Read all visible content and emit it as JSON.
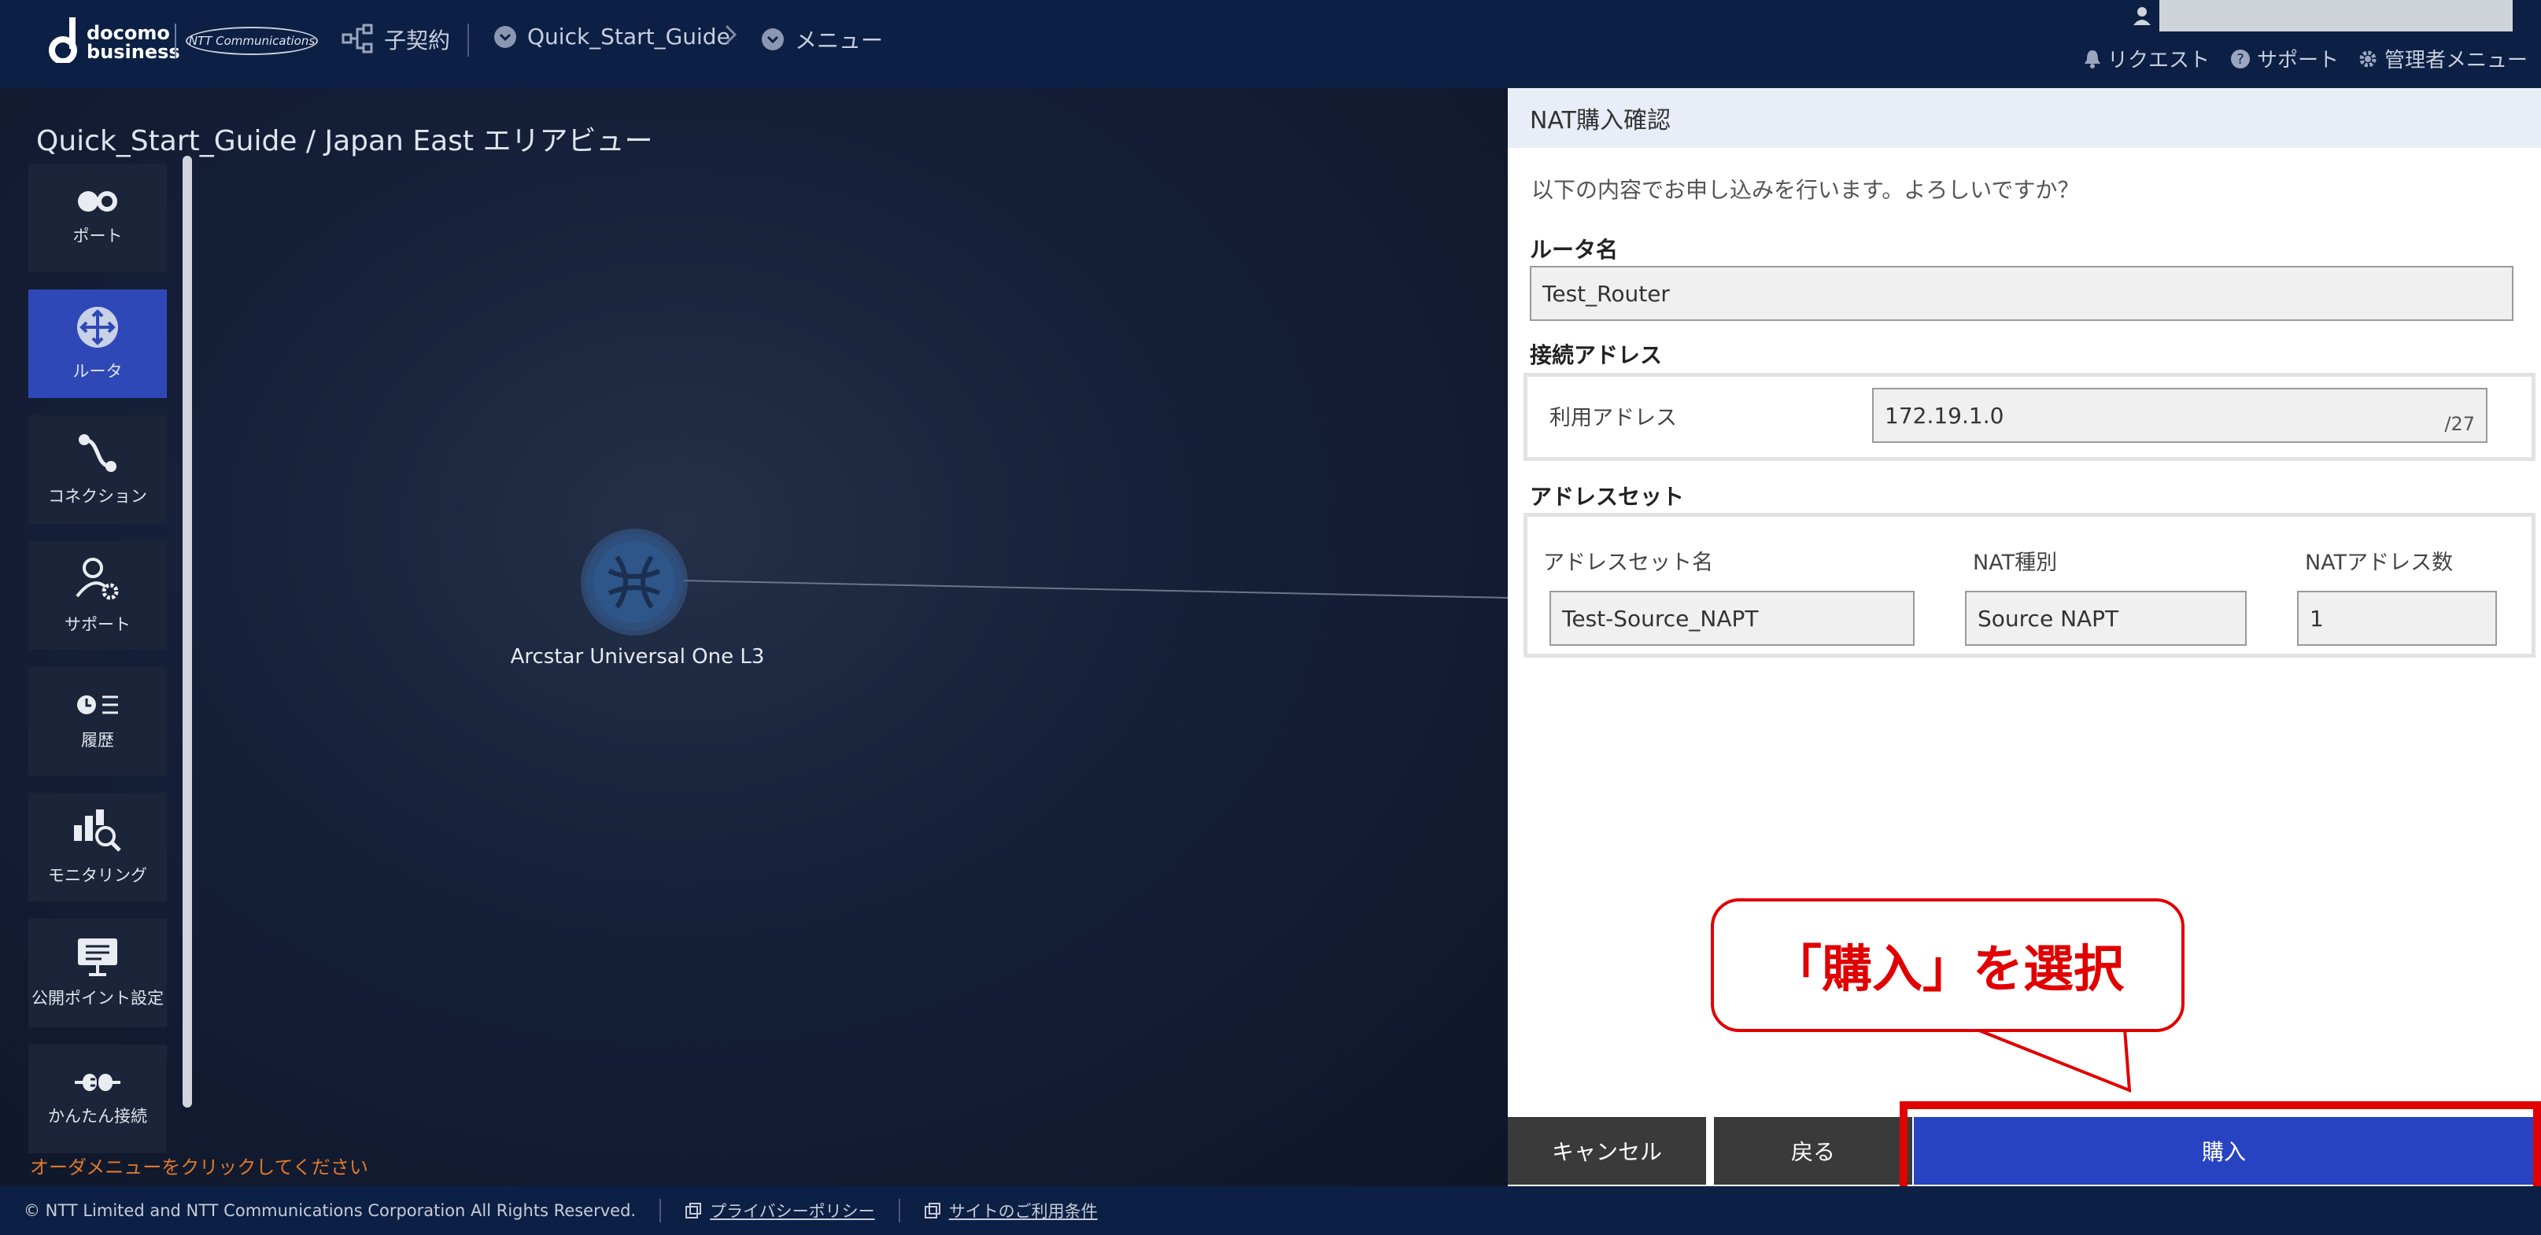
{
  "header": {
    "logo_text_line1": "docomo",
    "logo_text_line2": "business",
    "ntt_logo": "NTT Communications",
    "breadcrumb": [
      {
        "label": "子契約",
        "icon": "hierarchy-icon"
      },
      {
        "label": "Quick_Start_Guide",
        "icon": "chevron-circle-icon"
      },
      {
        "label": "メニュー",
        "icon": "chevron-circle-icon"
      }
    ],
    "right_links": [
      {
        "label": "リクエスト",
        "icon": "bell-icon"
      },
      {
        "label": "サポート",
        "icon": "question-icon"
      },
      {
        "label": "管理者メニュー",
        "icon": "gear-icon"
      }
    ]
  },
  "canvas": {
    "title": "Quick_Start_Guide / Japan East エリアビュー",
    "node_label": "Arcstar Universal One L3",
    "order_hint": "オーダメニューをクリックしてください"
  },
  "sidebar": {
    "items": [
      {
        "label": "ポート",
        "icon": "port-icon"
      },
      {
        "label": "ルータ",
        "icon": "router-icon",
        "active": true
      },
      {
        "label": "コネクション",
        "icon": "connection-icon"
      },
      {
        "label": "サポート",
        "icon": "support-icon"
      },
      {
        "label": "履歴",
        "icon": "history-icon"
      },
      {
        "label": "モニタリング",
        "icon": "monitoring-icon"
      },
      {
        "label": "公開ポイント設定",
        "icon": "publish-point-icon"
      },
      {
        "label": "かんたん接続",
        "icon": "easy-connect-icon"
      }
    ]
  },
  "panel": {
    "title": "NAT購入確認",
    "confirm_text": "以下の内容でお申し込みを行います。よろしいですか？",
    "router_name_label": "ルータ名",
    "router_name_value": "Test_Router",
    "connection_address_label": "接続アドレス",
    "use_address_label": "利用アドレス",
    "use_address_value": "172.19.1.0",
    "use_address_suffix": "/27",
    "address_set_label": "アドレスセット",
    "address_set_name_label": "アドレスセット名",
    "nat_type_label": "NAT種別",
    "nat_count_label": "NATアドレス数",
    "address_set_name_value": "Test-Source_NAPT",
    "nat_type_value": "Source NAPT",
    "nat_count_value": "1"
  },
  "buttons": {
    "cancel": "キャンセル",
    "back": "戻る",
    "buy": "購入"
  },
  "callout": {
    "text": "「購入」を選択"
  },
  "footer": {
    "copyright": "© NTT Limited and NTT Communications Corporation All Rights Reserved.",
    "privacy": "プライバシーポリシー",
    "terms": "サイトのご利用条件"
  },
  "colors": {
    "header_bg": "#0c1f44",
    "accent_blue": "#2743c2",
    "highlight_red": "#e00000",
    "hint_orange": "#e0792b"
  }
}
